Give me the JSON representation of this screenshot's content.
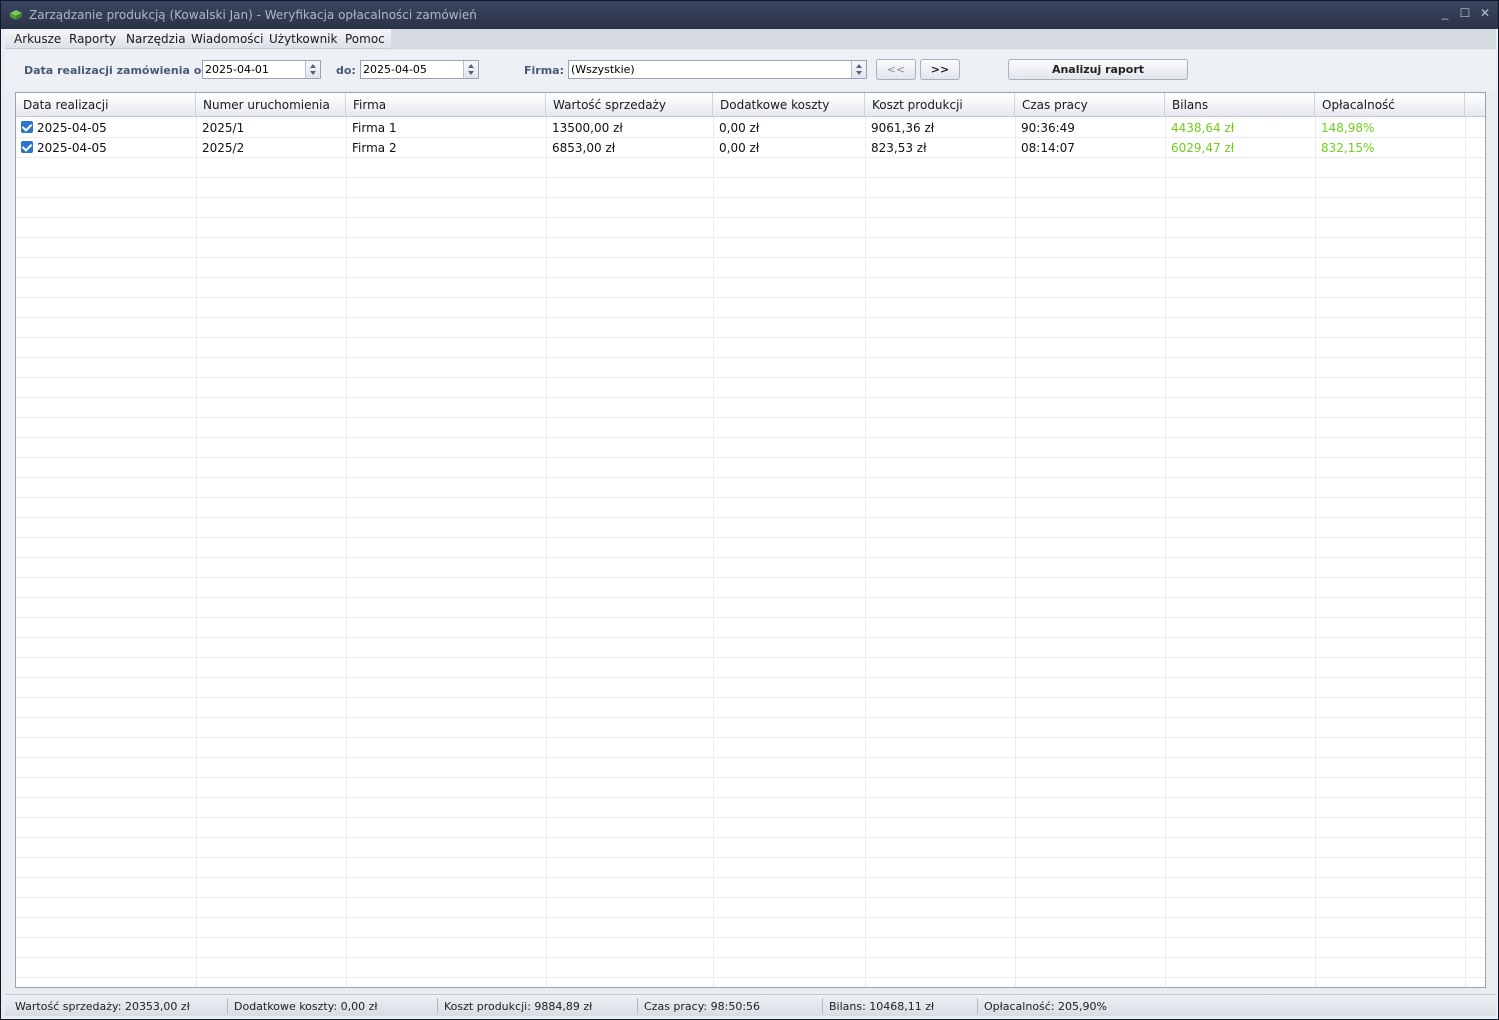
{
  "window": {
    "title": "Zarządzanie produkcją (Kowalski Jan) - Weryfikacja opłacalności zamówień",
    "minimize_glyph": "_",
    "maximize_glyph": "☐",
    "close_glyph": "✕"
  },
  "menu": [
    "Arkusze",
    "Raporty",
    "Narzędzia",
    "Wiadomości",
    "Użytkownik",
    "Pomoc"
  ],
  "filters": {
    "date_from_label": "Data realizacji zamówienia od:",
    "date_from_value": "2025-04-01",
    "date_to_label": "do:",
    "date_to_value": "2025-04-05",
    "firm_label": "Firma:",
    "firm_value": "(Wszystkie)",
    "prev_label": "<<",
    "next_label": ">>",
    "analyze_label": "Analizuj raport"
  },
  "table": {
    "columns": [
      "Data realizacji",
      "Numer uruchomienia",
      "Firma",
      "Wartość sprzedaży",
      "Dodatkowe koszty",
      "Koszt produkcji",
      "Czas pracy",
      "Bilans",
      "Opłacalność"
    ],
    "rows": [
      [
        "2025-04-05",
        "2025/1",
        "Firma 1",
        "13500,00 zł",
        "0,00 zł",
        "9061,36 zł",
        "90:36:49",
        "4438,64 zł",
        "148,98%"
      ],
      [
        "2025-04-05",
        "2025/2",
        "Firma 2",
        "6853,00 zł",
        "0,00 zł",
        "823,53 zł",
        "08:14:07",
        "6029,47 zł",
        "832,15%"
      ]
    ]
  },
  "colors": {
    "positive": "#6fcf1c",
    "checkbox": "#2c74c8"
  },
  "status": {
    "sales": "Wartość sprzedaży: 20353,00 zł",
    "extra": "Dodatkowe koszty: 0,00 zł",
    "production": "Koszt produkcji: 9884,89 zł",
    "time": "Czas pracy: 98:50:56",
    "balance": "Bilans: 10468,11 zł",
    "profitability": "Opłacalność: 205,90%"
  }
}
